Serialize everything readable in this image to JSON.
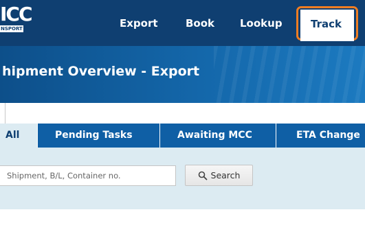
{
  "logo": {
    "text": "ICC",
    "subtext": "NSPORT"
  },
  "nav": {
    "export": "Export",
    "book": "Book",
    "lookup": "Lookup",
    "track": "Track"
  },
  "colors": {
    "nav_bg": "#0f3f71",
    "highlight_outline": "#ef7d22",
    "tab_bg": "#0f5fa5",
    "panel_bg": "#dcebf2"
  },
  "page": {
    "title": "hipment Overview - Export"
  },
  "tabs": [
    {
      "label": "All",
      "active": true
    },
    {
      "label": "Pending Tasks",
      "active": false
    },
    {
      "label": "Awaiting MCC",
      "active": false
    },
    {
      "label": "ETA Change",
      "active": false
    }
  ],
  "search": {
    "placeholder": "Shipment, B/L, Container no.",
    "value": "",
    "button_label": "Search",
    "button_icon": "search-icon"
  }
}
